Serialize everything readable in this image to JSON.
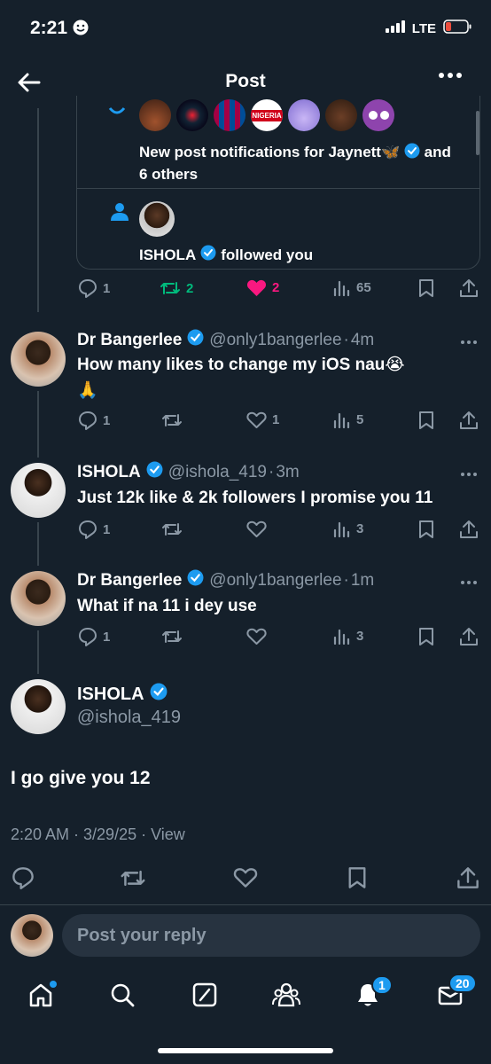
{
  "status_bar": {
    "time": "2:21",
    "network": "LTE"
  },
  "header": {
    "title": "Post"
  },
  "quoted_card": {
    "avatars": [
      "avatar-1",
      "avatar-2",
      "avatar-3",
      "avatar-4",
      "avatar-5",
      "avatar-6",
      "avatar-7"
    ],
    "avatar_badge_text": "NIGERIA",
    "notification_1": "New post notifications for Jaynett🦋",
    "notification_1_suffix": "and",
    "notification_1_line2": "6 others",
    "notification_2_name": "ISHOLA",
    "notification_2_text": "followed you"
  },
  "original_actions": {
    "replies": "1",
    "reposts": "2",
    "likes": "2",
    "views": "65"
  },
  "replies": [
    {
      "name": "Dr Bangerlee",
      "handle": "@only1bangerlee",
      "time": "4m",
      "text": "How many likes to change my iOS nau😭",
      "text_line2": "🙏",
      "replies": "1",
      "reposts": "",
      "likes": "1",
      "views": "5"
    },
    {
      "name": "ISHOLA",
      "handle": "@ishola_419",
      "time": "3m",
      "text": "Just 12k like & 2k followers I promise you 11",
      "replies": "1",
      "reposts": "",
      "likes": "",
      "views": "3"
    },
    {
      "name": "Dr Bangerlee",
      "handle": "@only1bangerlee",
      "time": "1m",
      "text": "What if na 11 i dey use",
      "replies": "1",
      "reposts": "",
      "likes": "",
      "views": "3"
    }
  ],
  "separator": "·",
  "main_post": {
    "name": "ISHOLA",
    "handle": "@ishola_419",
    "text": "I go give you 12",
    "meta": "2:20 AM · 3/29/25 · View"
  },
  "composer": {
    "placeholder": "Post your reply"
  },
  "tab_bar": {
    "notifications_badge": "1",
    "messages_badge": "20"
  },
  "colors": {
    "background": "#15202b",
    "accent": "#1d9bf0",
    "like": "#f91880",
    "repost": "#00ba7c",
    "muted": "#8b98a5"
  }
}
